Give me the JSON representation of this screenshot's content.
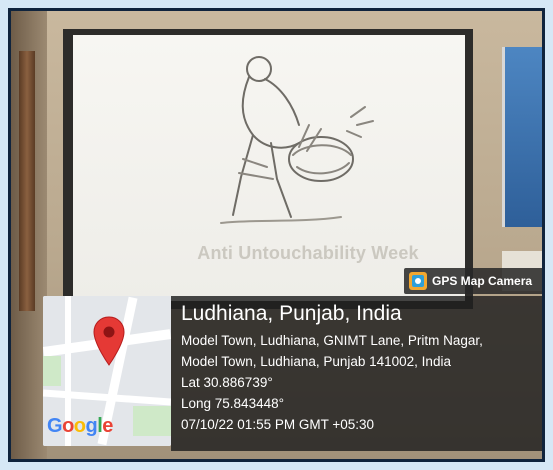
{
  "screen": {
    "caption": "Anti Untouchability Week"
  },
  "badge": {
    "label": "GPS Map Camera",
    "icon": "gps-map-camera-logo"
  },
  "map": {
    "brand": "Google",
    "pin_color": "#e53935"
  },
  "location": {
    "title": "Ludhiana, Punjab, India",
    "address_line1": "Model Town, Ludhiana, GNIMT Lane, Pritm Nagar,",
    "address_line2": "Model Town, Ludhiana, Punjab 141002, India",
    "latitude": "Lat 30.886739°",
    "longitude": "Long 75.843448°",
    "timestamp": "07/10/22 01:55 PM GMT +05:30"
  },
  "colors": {
    "frame": "#d6e8f6",
    "border": "#10243d",
    "panel": "#1e1e1e"
  }
}
